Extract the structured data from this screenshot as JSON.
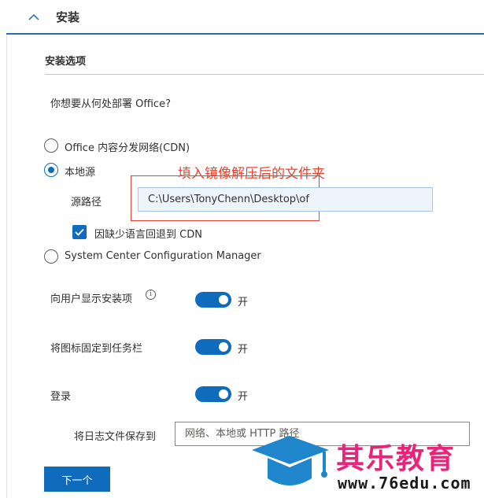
{
  "header": {
    "title": "安装"
  },
  "section": {
    "title": "安装选项"
  },
  "question": "你想要从何处部署 Office?",
  "source_options": [
    {
      "label": "Office 内容分发网络(CDN)",
      "checked": false
    },
    {
      "label": "本地源",
      "checked": true
    },
    {
      "label": "System Center Configuration Manager",
      "checked": false
    }
  ],
  "annotation": "填入镜像解压后的文件夹",
  "source_path": {
    "label": "源路径",
    "value": "C:\\Users\\TonyChenn\\Desktop\\of"
  },
  "fallback": {
    "label": "因缺少语言回退到 CDN",
    "checked": true
  },
  "toggles": [
    {
      "label": "向用户显示安装项",
      "state": "开",
      "on": true,
      "icon": "info-icon"
    },
    {
      "label": "将图标固定到任务栏",
      "state": "开",
      "on": true
    },
    {
      "label": "登录",
      "state": "开",
      "on": true
    }
  ],
  "log": {
    "label": "将日志文件保存到",
    "placeholder": "网络、本地或 HTTP 路径"
  },
  "next_button": "下一个",
  "watermark": {
    "text": "其乐教育",
    "url": "www.76edu.com"
  },
  "colors": {
    "accent": "#0f6cbd",
    "annotation": "#e8432f",
    "watermark": "#e8237a"
  }
}
